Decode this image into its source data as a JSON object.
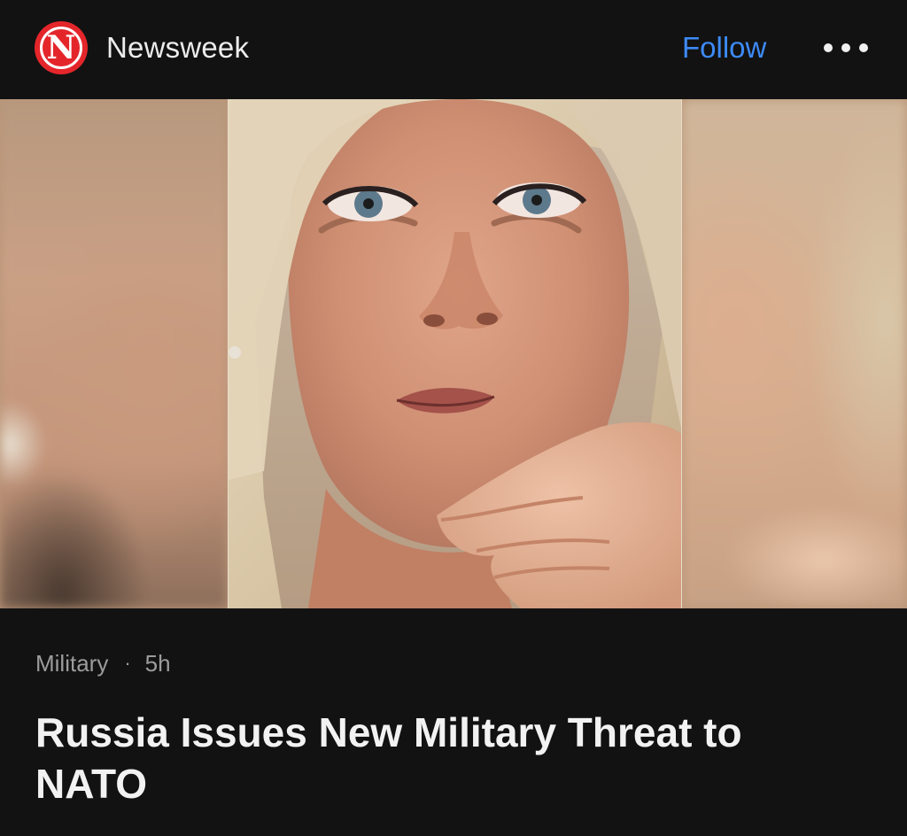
{
  "header": {
    "logo_letter": "N",
    "publisher": "Newsweek",
    "follow_label": "Follow"
  },
  "article": {
    "category": "Military",
    "separator": "·",
    "age": "5h",
    "headline": "Russia Issues New Military Threat to NATO"
  },
  "colors": {
    "background": "#121212",
    "accent": "#3d8af7",
    "logo_red": "#e4262b"
  },
  "icons": [
    "more-options-icon"
  ]
}
